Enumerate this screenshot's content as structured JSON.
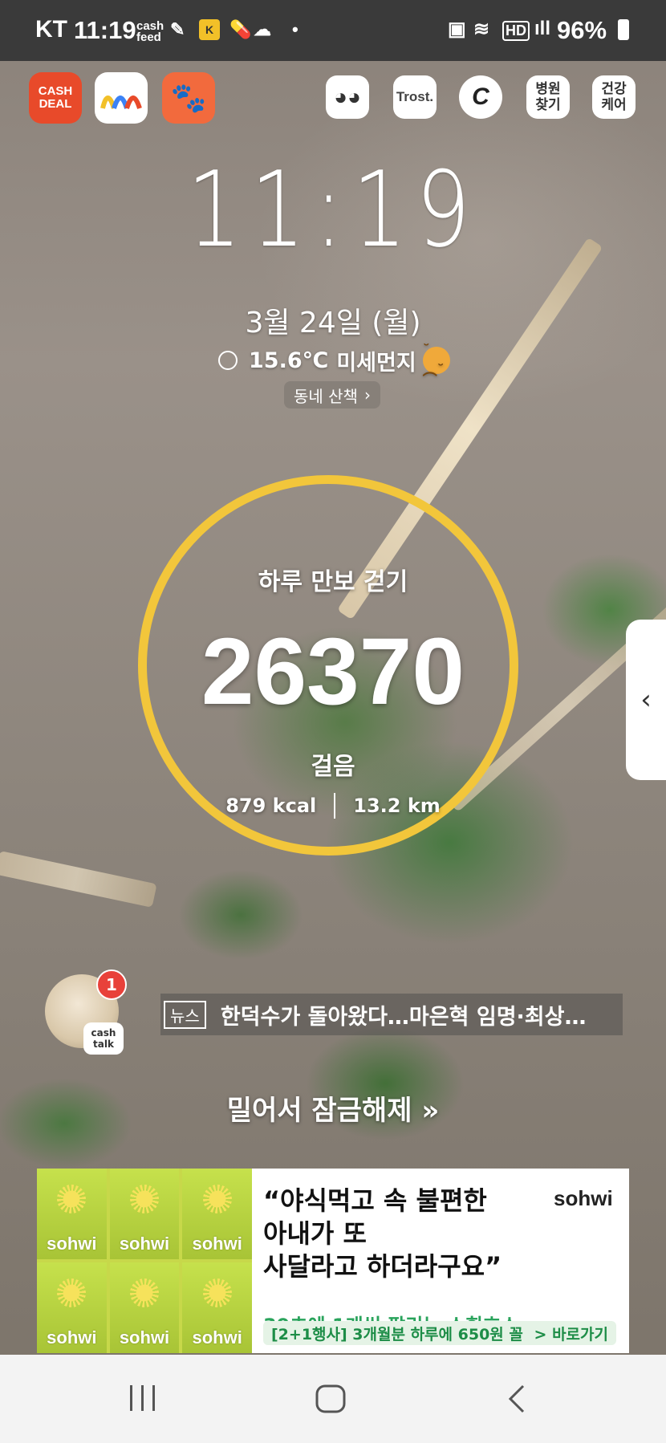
{
  "status_bar": {
    "carrier": "KT",
    "time": "11:19",
    "battery_percent": "96%"
  },
  "apps": [
    {
      "name": "CASH DEAL",
      "label": "CASH\nDEAL",
      "color": "#e84a2a"
    },
    {
      "name": "mm",
      "label": "",
      "color": "#ffffff"
    },
    {
      "name": "paw",
      "label": "",
      "color": "#f26a3d"
    },
    {
      "name": "doge",
      "label": "",
      "color": "#ffffff"
    },
    {
      "name": "Trost",
      "label": "Trost.",
      "color": "#ffffff"
    },
    {
      "name": "C",
      "label": "C",
      "color": "#ffffff"
    },
    {
      "name": "병원찾기",
      "label": "병원\n찾기",
      "color": "#ffffff"
    },
    {
      "name": "건강케어",
      "label": "건강\n케어",
      "color": "#ffffff"
    }
  ],
  "lock": {
    "clock": "11:19",
    "date": "3월 24일 (월)",
    "weather_temp": "15.6℃",
    "weather_dust": "미세먼지",
    "walk_link": "동네 산책",
    "unlock_text": "밀어서 잠금해제"
  },
  "steps": {
    "title": "하루 만보 걷기",
    "count": "26370",
    "unit": "걸음",
    "kcal": "879 kcal",
    "distance": "13.2 km"
  },
  "news": {
    "badge": "1",
    "cashtalk": "cash talk",
    "tag": "뉴스",
    "headline": "한덕수가 돌아왔다…마은혁 임명·최상…"
  },
  "ad": {
    "brand": "sohwi",
    "headline_1": "“야식먹고 속 불편한",
    "headline_2": "아내가 또",
    "headline_3": "사달라고 하더라구요”",
    "sub": "39초에 1개씩 팔리는 소휘효소",
    "cta_left": "[2+1행사] 3개월분 하루에 650원 꼴",
    "cta_right": "> 바로가기",
    "box_label": "sohwi"
  },
  "colors": {
    "ring": "#f2c63b",
    "status_bar": "#3a3a3a",
    "ad_green": "#29a35b"
  }
}
